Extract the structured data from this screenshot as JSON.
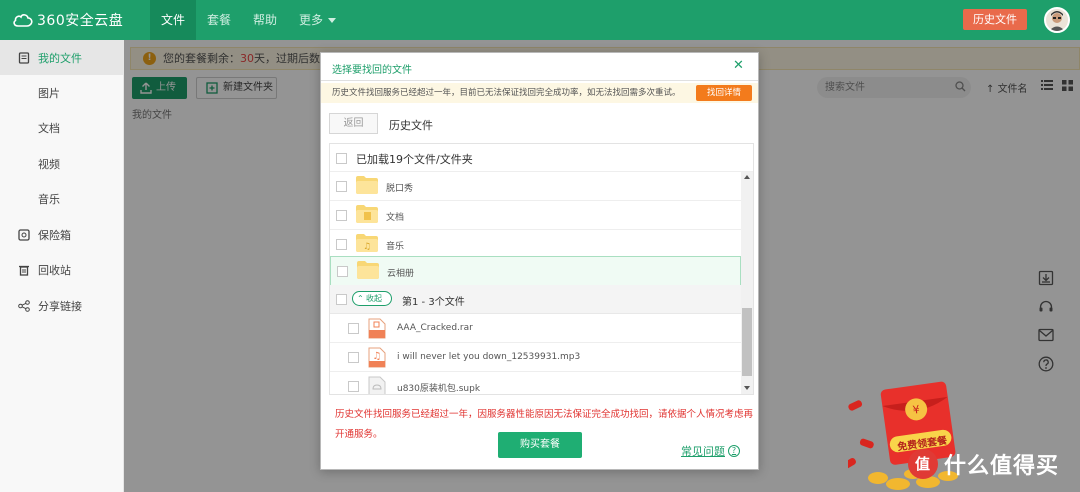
{
  "app": {
    "logo_text": "360安全云盘"
  },
  "nav": {
    "items": [
      "文件",
      "套餐",
      "帮助",
      "更多"
    ],
    "active_index": 0
  },
  "header": {
    "history_button": "历史文件"
  },
  "sidebar": {
    "items": [
      {
        "label": "我的文件",
        "icon": "file-icon"
      },
      {
        "label": "图片"
      },
      {
        "label": "文档"
      },
      {
        "label": "视频"
      },
      {
        "label": "音乐"
      },
      {
        "label": "保险箱",
        "icon": "safe-icon"
      },
      {
        "label": "回收站",
        "icon": "trash-icon"
      },
      {
        "label": "分享链接",
        "icon": "share-icon"
      }
    ]
  },
  "notice": {
    "prefix": "您的套餐剩余：",
    "days": "30",
    "suffix": "天，过期后数据为"
  },
  "toolbar": {
    "upload_label": "上传",
    "new_folder_label": "新建文件夹",
    "search_placeholder": "搜索文件",
    "sort_label": "文件名"
  },
  "breadcrumb": "我的文件",
  "modal": {
    "title": "选择要找回的文件",
    "warning": "历史文件找回服务已经超过一年，目前已无法保证找回完全成功率，如无法找回需多次重试。",
    "warning_button": "找回详情",
    "back_button": "返回",
    "crumb": "历史文件",
    "loaded_label": "已加载19个文件/文件夹",
    "folders": [
      "脱口秀",
      "文档",
      "音乐",
      "云相册"
    ],
    "group": {
      "collapse_label": "收起",
      "label": "第1 - 3个文件"
    },
    "files": [
      "AAA_Cracked.rar",
      "i will never let you down_12539931.mp3",
      "u830原装机包.supk"
    ],
    "footer_notice": "历史文件找回服务已经超过一年，因服务器性能原因无法保证完全成功找回，请依据个人情况考虑再开通服务。",
    "buy_button": "购买套餐",
    "faq_link": "常见问题"
  },
  "promo": {
    "badge_text": "免费领套餐"
  },
  "watermark": {
    "text": "什么值得买",
    "logo_char": "值"
  },
  "colors": {
    "brand_green": "#1e9f6b",
    "warn_orange": "#f37b1c",
    "alert_red": "#e0322f"
  }
}
